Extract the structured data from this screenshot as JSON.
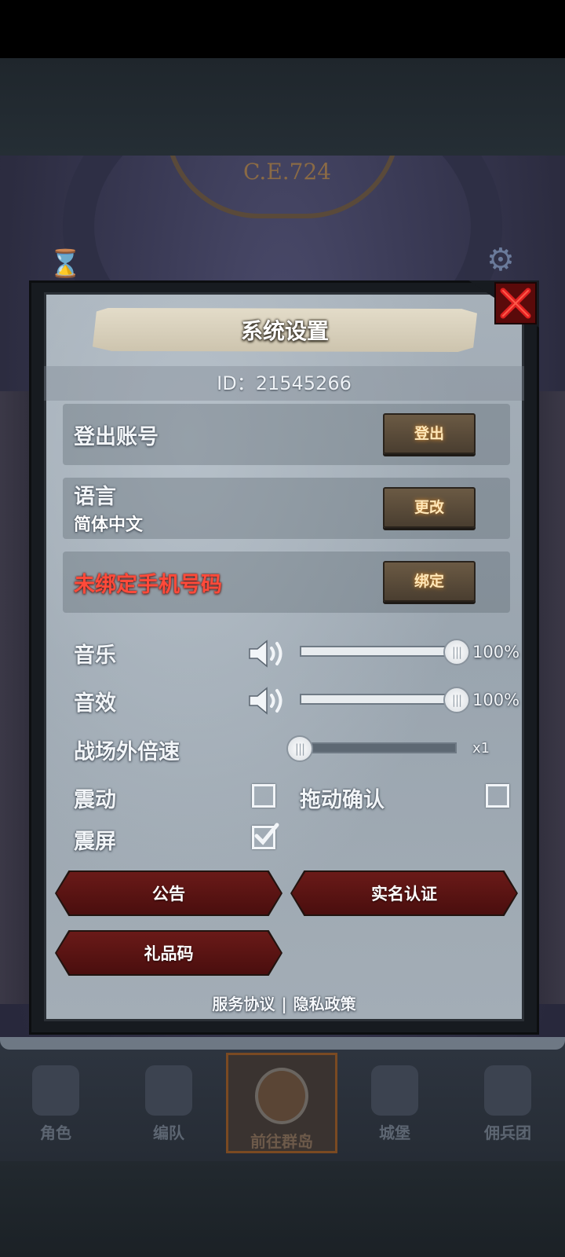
{
  "background": {
    "era_label": "C.E.724"
  },
  "nav": {
    "items": [
      {
        "label": "角色"
      },
      {
        "label": "编队"
      },
      {
        "label": "前往群岛"
      },
      {
        "label": "城堡"
      },
      {
        "label": "佣兵团"
      }
    ],
    "active_index": 2
  },
  "dialog": {
    "title": "系统设置",
    "id_line": "ID：21545266",
    "logout": {
      "label": "登出账号",
      "button": "登出"
    },
    "language": {
      "label": "语言",
      "value": "简体中文",
      "button": "更改"
    },
    "phone": {
      "label": "未绑定手机号码",
      "button": "绑定",
      "label_color": "#ff4a3a"
    },
    "music": {
      "label": "音乐",
      "percent_text": "100%",
      "level": 1.0
    },
    "sfx": {
      "label": "音效",
      "percent_text": "100%",
      "level": 1.0
    },
    "speed": {
      "label": "战场外倍速",
      "value_text": "x1",
      "level": 0.0
    },
    "vibration": {
      "label": "震动",
      "checked": false
    },
    "drag_confirm": {
      "label": "拖动确认",
      "checked": false
    },
    "screen_shake": {
      "label": "震屏",
      "checked": true
    },
    "buttons": {
      "announcement": "公告",
      "real_name": "实名认证",
      "gift_code": "礼品码"
    },
    "footer": {
      "terms": "服务协议",
      "separator": "|",
      "privacy": "隐私政策"
    }
  },
  "colors": {
    "accent_red": "#6a1a18",
    "button_glow": "#ffe7b8",
    "close_red": "#e02020"
  }
}
